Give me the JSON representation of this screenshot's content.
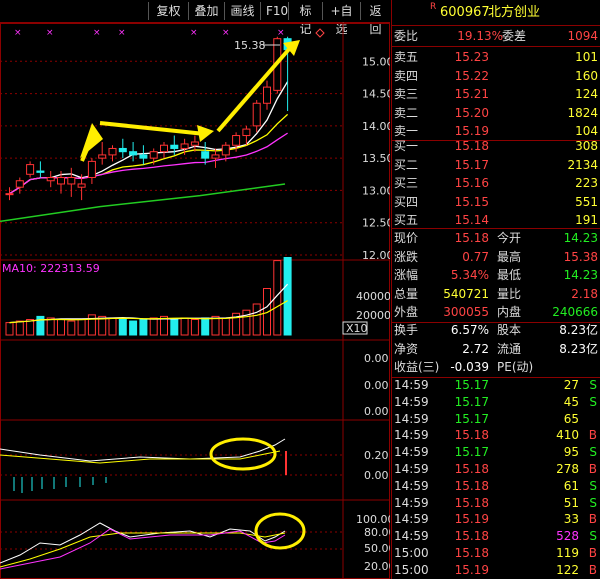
{
  "toolbar": {
    "items": [
      "复权",
      "叠加",
      "画线",
      "F10",
      "标记",
      "+自选",
      "返回"
    ]
  },
  "stock": {
    "code": "600967",
    "name": "北方创业",
    "badge": "R"
  },
  "quote_head": {
    "weibi_label": "委比",
    "weibi_value": "19.13%",
    "weicha_label": "委差",
    "weicha_value": "1094"
  },
  "sell_orders": [
    {
      "label": "卖五",
      "price": "15.23",
      "vol": "101"
    },
    {
      "label": "卖四",
      "price": "15.22",
      "vol": "160"
    },
    {
      "label": "卖三",
      "price": "15.21",
      "vol": "124"
    },
    {
      "label": "卖二",
      "price": "15.20",
      "vol": "1824"
    },
    {
      "label": "卖一",
      "price": "15.19",
      "vol": "104"
    }
  ],
  "buy_orders": [
    {
      "label": "买一",
      "price": "15.18",
      "vol": "308"
    },
    {
      "label": "买二",
      "price": "15.17",
      "vol": "2134"
    },
    {
      "label": "买三",
      "price": "15.16",
      "vol": "223"
    },
    {
      "label": "买四",
      "price": "15.15",
      "vol": "551"
    },
    {
      "label": "买五",
      "price": "15.14",
      "vol": "191"
    }
  ],
  "stats": [
    {
      "l1": "现价",
      "v1": "15.18",
      "c1": "red",
      "l2": "今开",
      "v2": "14.23",
      "c2": "green"
    },
    {
      "l1": "涨跌",
      "v1": "0.77",
      "c1": "red",
      "l2": "最高",
      "v2": "15.38",
      "c2": "red"
    },
    {
      "l1": "涨幅",
      "v1": "5.34%",
      "c1": "red",
      "l2": "最低",
      "v2": "14.23",
      "c2": "green"
    },
    {
      "l1": "总量",
      "v1": "540721",
      "c1": "yellow",
      "l2": "量比",
      "v2": "2.18",
      "c2": "red"
    },
    {
      "l1": "外盘",
      "v1": "300055",
      "c1": "red",
      "l2": "内盘",
      "v2": "240666",
      "c2": "green"
    }
  ],
  "stats2": [
    {
      "l1": "换手",
      "v1": "6.57%",
      "c1": "white",
      "l2": "股本",
      "v2": "8.23亿",
      "c2": "white"
    },
    {
      "l1": "净资",
      "v1": "2.72",
      "c1": "white",
      "l2": "流通",
      "v2": "8.23亿",
      "c2": "white"
    },
    {
      "l1": "收益(三)",
      "v1": "-0.039",
      "c1": "white",
      "l2": "PE(动)",
      "v2": "",
      "c2": "white"
    }
  ],
  "ticks": [
    {
      "time": "14:59",
      "price": "15.17",
      "vol": "27",
      "side": "S",
      "pc": "green",
      "vc": "yellow",
      "sc": "green"
    },
    {
      "time": "14:59",
      "price": "15.17",
      "vol": "45",
      "side": "S",
      "pc": "green",
      "vc": "yellow",
      "sc": "green"
    },
    {
      "time": "14:59",
      "price": "15.17",
      "vol": "65",
      "side": "",
      "pc": "green",
      "vc": "yellow",
      "sc": "green"
    },
    {
      "time": "14:59",
      "price": "15.18",
      "vol": "410",
      "side": "B",
      "pc": "red",
      "vc": "yellow",
      "sc": "red"
    },
    {
      "time": "14:59",
      "price": "15.17",
      "vol": "95",
      "side": "S",
      "pc": "green",
      "vc": "yellow",
      "sc": "green"
    },
    {
      "time": "14:59",
      "price": "15.18",
      "vol": "278",
      "side": "B",
      "pc": "red",
      "vc": "yellow",
      "sc": "red"
    },
    {
      "time": "14:59",
      "price": "15.18",
      "vol": "61",
      "side": "S",
      "pc": "red",
      "vc": "yellow",
      "sc": "green"
    },
    {
      "time": "14:59",
      "price": "15.18",
      "vol": "51",
      "side": "S",
      "pc": "red",
      "vc": "yellow",
      "sc": "green"
    },
    {
      "time": "14:59",
      "price": "15.19",
      "vol": "33",
      "side": "B",
      "pc": "red",
      "vc": "yellow",
      "sc": "red"
    },
    {
      "time": "14:59",
      "price": "15.18",
      "vol": "528",
      "side": "S",
      "pc": "red",
      "vc": "magenta",
      "sc": "green"
    },
    {
      "time": "15:00",
      "price": "15.18",
      "vol": "119",
      "side": "B",
      "pc": "red",
      "vc": "yellow",
      "sc": "red"
    },
    {
      "time": "15:00",
      "price": "15.19",
      "vol": "122",
      "side": "B",
      "pc": "red",
      "vc": "yellow",
      "sc": "red"
    }
  ],
  "chart": {
    "price_axis": [
      "15.00",
      "14.50",
      "14.00",
      "13.50",
      "13.00",
      "12.50",
      "12.00"
    ],
    "high_label": "15.38",
    "ma_label": "MA10: 222313.59",
    "vol_axis": [
      "40000",
      "20000"
    ],
    "vol_unit": "X10",
    "p3_axis": [
      "0.00",
      "0.00",
      "0.00"
    ],
    "p4_axis": [
      "0.20",
      "0.00"
    ],
    "p5_axis": [
      "100.00",
      "80.00",
      "50.00",
      "20.00"
    ]
  },
  "colors": {
    "up": "#ff3333",
    "down": "#22eeee",
    "ma5": "#ffffff",
    "ma10": "#ffff00",
    "ma20": "#ff33ff",
    "ma60": "#22cc22",
    "frame": "#8b0000"
  },
  "chart_data": {
    "type": "candlestick",
    "candles": [
      {
        "o": 12.95,
        "h": 13.05,
        "l": 12.85,
        "c": 12.95
      },
      {
        "o": 13.05,
        "h": 13.2,
        "l": 12.95,
        "c": 13.15
      },
      {
        "o": 13.25,
        "h": 13.45,
        "l": 13.2,
        "c": 13.4
      },
      {
        "o": 13.3,
        "h": 13.45,
        "l": 13.2,
        "c": 13.28
      },
      {
        "o": 13.15,
        "h": 13.3,
        "l": 13.05,
        "c": 13.2
      },
      {
        "o": 13.1,
        "h": 13.3,
        "l": 12.95,
        "c": 13.2
      },
      {
        "o": 13.1,
        "h": 13.35,
        "l": 12.9,
        "c": 13.2
      },
      {
        "o": 13.05,
        "h": 13.25,
        "l": 12.85,
        "c": 13.1
      },
      {
        "o": 13.2,
        "h": 13.5,
        "l": 13.1,
        "c": 13.45
      },
      {
        "o": 13.5,
        "h": 13.75,
        "l": 13.4,
        "c": 13.55
      },
      {
        "o": 13.55,
        "h": 13.7,
        "l": 13.45,
        "c": 13.65
      },
      {
        "o": 13.65,
        "h": 13.8,
        "l": 13.5,
        "c": 13.6
      },
      {
        "o": 13.6,
        "h": 13.75,
        "l": 13.45,
        "c": 13.55
      },
      {
        "o": 13.55,
        "h": 13.7,
        "l": 13.4,
        "c": 13.5
      },
      {
        "o": 13.5,
        "h": 13.65,
        "l": 13.4,
        "c": 13.6
      },
      {
        "o": 13.6,
        "h": 13.75,
        "l": 13.5,
        "c": 13.7
      },
      {
        "o": 13.7,
        "h": 13.85,
        "l": 13.55,
        "c": 13.65
      },
      {
        "o": 13.65,
        "h": 13.8,
        "l": 13.55,
        "c": 13.72
      },
      {
        "o": 13.7,
        "h": 13.85,
        "l": 13.6,
        "c": 13.75
      },
      {
        "o": 13.6,
        "h": 13.75,
        "l": 13.4,
        "c": 13.5
      },
      {
        "o": 13.5,
        "h": 13.65,
        "l": 13.35,
        "c": 13.55
      },
      {
        "o": 13.55,
        "h": 13.75,
        "l": 13.45,
        "c": 13.7
      },
      {
        "o": 13.7,
        "h": 13.9,
        "l": 13.6,
        "c": 13.85
      },
      {
        "o": 13.85,
        "h": 14.0,
        "l": 13.7,
        "c": 13.95
      },
      {
        "o": 14.0,
        "h": 14.4,
        "l": 13.9,
        "c": 14.35
      },
      {
        "o": 14.35,
        "h": 14.7,
        "l": 14.25,
        "c": 14.6
      },
      {
        "o": 14.55,
        "h": 15.38,
        "l": 14.5,
        "c": 15.35
      },
      {
        "o": 15.35,
        "h": 15.38,
        "l": 14.23,
        "c": 15.18
      }
    ],
    "volumes": [
      8,
      9,
      10,
      12,
      11,
      10,
      9,
      10,
      13,
      12,
      11,
      10,
      9,
      10,
      11,
      12,
      10,
      11,
      10,
      11,
      12,
      11,
      14,
      16,
      20,
      30,
      48,
      50
    ],
    "price_ylim": [
      12.0,
      15.5
    ]
  }
}
